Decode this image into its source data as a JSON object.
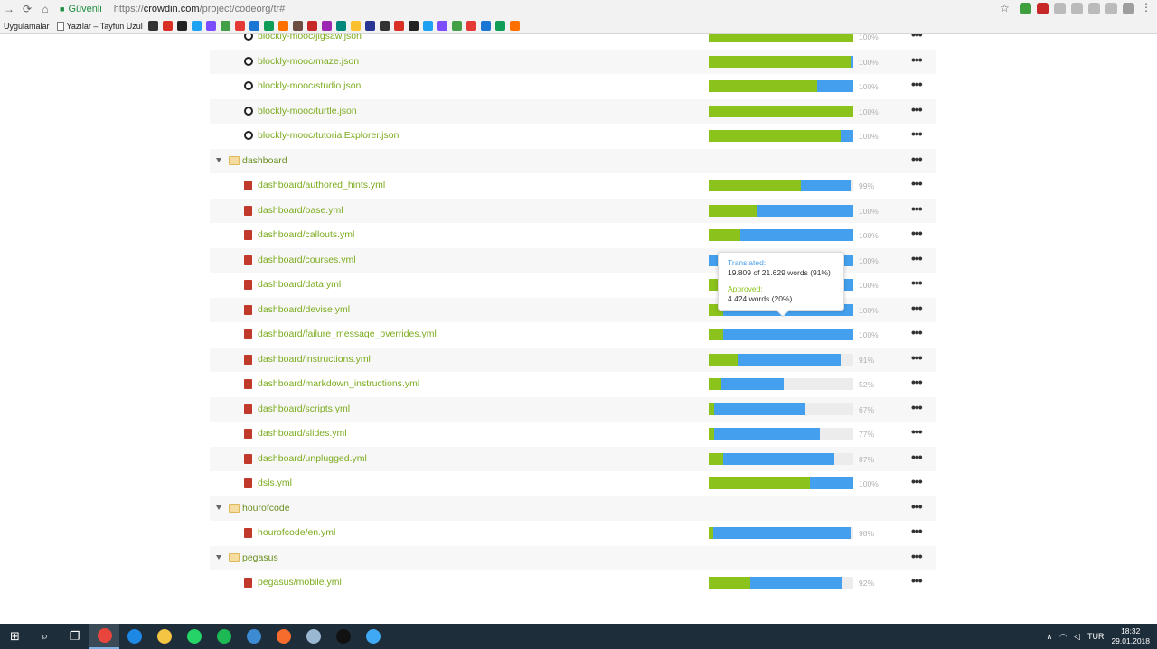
{
  "browser": {
    "secure_label": "Güvenli",
    "url_prefix": "https://",
    "url_host": "crowdin.com",
    "url_path": "/project/codeorg/tr#",
    "apps_label": "Uygulamalar",
    "bookmark_page_label": "Yazılar – Tayfun Uzul",
    "accent_colors": [
      "#333333",
      "#d93025",
      "#222222",
      "#1da1f2",
      "#7c4dff",
      "#43a047",
      "#e53935",
      "#1976d2",
      "#0f9d58",
      "#ff6f00",
      "#6d4c41",
      "#c62828",
      "#9c27b0",
      "#00897b",
      "#fbc02d",
      "#283593"
    ]
  },
  "files": {
    "rows": [
      {
        "kind": "file",
        "ext": "json",
        "name": "blockly-mooc/jigsaw.json",
        "approved": 100,
        "translated": 100,
        "pct": "100%"
      },
      {
        "kind": "file",
        "ext": "json",
        "name": "blockly-mooc/maze.json",
        "approved": 99,
        "translated": 100,
        "pct": "100%"
      },
      {
        "kind": "file",
        "ext": "json",
        "name": "blockly-mooc/studio.json",
        "approved": 75,
        "translated": 100,
        "pct": "100%"
      },
      {
        "kind": "file",
        "ext": "json",
        "name": "blockly-mooc/turtle.json",
        "approved": 100,
        "translated": 100,
        "pct": "100%"
      },
      {
        "kind": "file",
        "ext": "json",
        "name": "blockly-mooc/tutorialExplorer.json",
        "approved": 91,
        "translated": 100,
        "pct": "100%"
      },
      {
        "kind": "folder",
        "name": "dashboard"
      },
      {
        "kind": "file",
        "ext": "yml",
        "name": "dashboard/authored_hints.yml",
        "approved": 64,
        "translated": 99,
        "pct": "99%"
      },
      {
        "kind": "file",
        "ext": "yml",
        "name": "dashboard/base.yml",
        "approved": 34,
        "translated": 100,
        "pct": "100%"
      },
      {
        "kind": "file",
        "ext": "yml",
        "name": "dashboard/callouts.yml",
        "approved": 22,
        "translated": 100,
        "pct": "100%"
      },
      {
        "kind": "file",
        "ext": "yml",
        "name": "dashboard/courses.yml",
        "approved": 0,
        "translated": 100,
        "pct": "100%"
      },
      {
        "kind": "file",
        "ext": "yml",
        "name": "dashboard/data.yml",
        "approved": 11,
        "translated": 100,
        "pct": "100%"
      },
      {
        "kind": "file",
        "ext": "yml",
        "name": "dashboard/devise.yml",
        "approved": 10,
        "translated": 100,
        "pct": "100%"
      },
      {
        "kind": "file",
        "ext": "yml",
        "name": "dashboard/failure_message_overrides.yml",
        "approved": 10,
        "translated": 100,
        "pct": "100%"
      },
      {
        "kind": "file",
        "ext": "yml",
        "name": "dashboard/instructions.yml",
        "approved": 20,
        "translated": 91,
        "pct": "91%"
      },
      {
        "kind": "file",
        "ext": "yml",
        "name": "dashboard/markdown_instructions.yml",
        "approved": 9,
        "translated": 52,
        "pct": "52%"
      },
      {
        "kind": "file",
        "ext": "yml",
        "name": "dashboard/scripts.yml",
        "approved": 4,
        "translated": 67,
        "pct": "67%"
      },
      {
        "kind": "file",
        "ext": "yml",
        "name": "dashboard/slides.yml",
        "approved": 4,
        "translated": 77,
        "pct": "77%"
      },
      {
        "kind": "file",
        "ext": "yml",
        "name": "dashboard/unplugged.yml",
        "approved": 10,
        "translated": 87,
        "pct": "87%"
      },
      {
        "kind": "file",
        "ext": "yml",
        "name": "dsls.yml",
        "approved": 70,
        "translated": 100,
        "pct": "100%"
      },
      {
        "kind": "folder",
        "name": "hourofcode"
      },
      {
        "kind": "file",
        "ext": "yml",
        "name": "hourofcode/en.yml",
        "approved": 3,
        "translated": 98,
        "pct": "98%"
      },
      {
        "kind": "folder",
        "name": "pegasus"
      },
      {
        "kind": "file",
        "ext": "yml",
        "name": "pegasus/mobile.yml",
        "approved": 29,
        "translated": 92,
        "pct": "92%"
      }
    ],
    "menu_glyph": "•••"
  },
  "tooltip": {
    "translated_label": "Translated:",
    "translated_value": "19.809 of 21.629 words (91%)",
    "approved_label": "Approved:",
    "approved_value": "4.424 words (20%)"
  },
  "taskbar": {
    "lang": "TUR",
    "time": "18:32",
    "date": "29.01.2018",
    "apps": [
      {
        "name": "windows-logo",
        "glyph": "⊞"
      },
      {
        "name": "search",
        "glyph": "⌕"
      },
      {
        "name": "task-view",
        "glyph": "❐"
      },
      {
        "name": "chrome",
        "color": "#e8453c"
      },
      {
        "name": "edge",
        "color": "#1e88e5"
      },
      {
        "name": "file-explorer",
        "color": "#f4c542"
      },
      {
        "name": "whatsapp",
        "color": "#25d366"
      },
      {
        "name": "spotify",
        "color": "#1db954"
      },
      {
        "name": "uplay",
        "color": "#3d8bd3"
      },
      {
        "name": "origin",
        "color": "#f56c2d"
      },
      {
        "name": "steam",
        "color": "#9bb8d3"
      },
      {
        "name": "app-black",
        "color": "#111111"
      },
      {
        "name": "app-link",
        "color": "#3fa9f5"
      }
    ]
  }
}
